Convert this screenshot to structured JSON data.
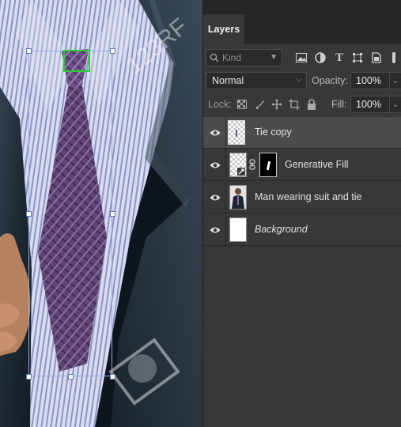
{
  "panel": {
    "tab_label": "Layers",
    "filter": {
      "kind_placeholder": "Kind",
      "icons": [
        "image-filter-icon",
        "adjustment-filter-icon",
        "type-filter-icon",
        "shape-filter-icon",
        "smart-object-filter-icon"
      ]
    },
    "blend_mode": "Normal",
    "opacity_label": "Opacity:",
    "opacity_value": "100%",
    "lock_label": "Lock:",
    "lock_icons": [
      "lock-transparent-pixels-icon",
      "lock-image-pixels-icon",
      "lock-position-icon",
      "lock-artboard-icon",
      "lock-all-icon"
    ],
    "fill_label": "Fill:",
    "fill_value": "100%"
  },
  "layers": [
    {
      "name": "Tie copy",
      "selected": true,
      "visible": true,
      "italic": false
    },
    {
      "name": "Generative Fill",
      "selected": false,
      "visible": true,
      "italic": false
    },
    {
      "name": "Man wearing suit and tie",
      "selected": false,
      "visible": true,
      "italic": false
    },
    {
      "name": "Background",
      "selected": false,
      "visible": true,
      "italic": true
    }
  ],
  "canvas": {
    "watermark_text": "123RF",
    "selection_color": "#25d12b",
    "transform_box_color": "#8fb0e6"
  },
  "colors": {
    "panel_bg": "#383838",
    "tab_bar_bg": "#262626",
    "selected_row": "#4b4b4b"
  }
}
